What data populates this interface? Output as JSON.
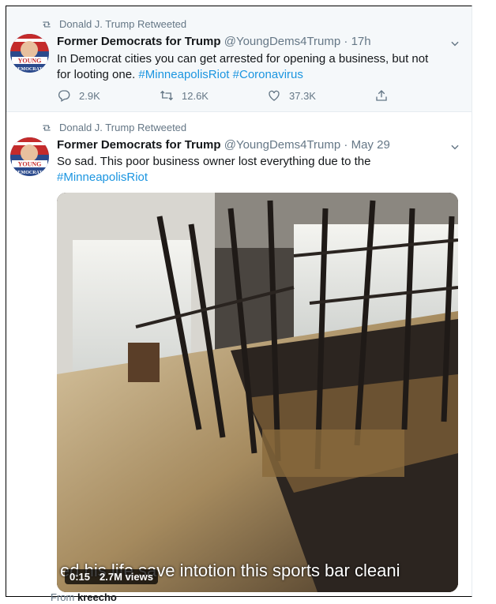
{
  "tweets": [
    {
      "retweeted_by": "Donald J. Trump Retweeted",
      "name": "Former Democrats for Trump",
      "handle": "@YoungDems4Trump",
      "sep": "·",
      "time": "17h",
      "text_plain": "In Democrat cities you can get arrested for opening a business, but not for looting one. ",
      "hashtags": [
        "#MinneapolisRiot",
        "#Coronavirus"
      ],
      "reply_count": "2.9K",
      "retweet_count": "12.6K",
      "like_count": "37.3K",
      "avatar_text": [
        "YOUNG",
        "DEMOCRATS"
      ]
    },
    {
      "retweeted_by": "Donald J. Trump Retweeted",
      "name": "Former Democrats for Trump",
      "handle": "@YoungDems4Trump",
      "sep": "·",
      "time": "May 29",
      "text_plain": "So sad. This poor business owner lost everything due to the",
      "hashtags": [
        "#MinneapolisRiot"
      ],
      "avatar_text": [
        "YOUNG",
        "DEMOCRATS"
      ],
      "video": {
        "caption": "ed his life save intotion this sports bar cleani",
        "duration": "0:15",
        "views": "2.7M views"
      },
      "from_label": "From",
      "from_user": "kreecho"
    }
  ],
  "colors": {
    "link": "#1b95e0",
    "muted": "#657786",
    "highlight_bg": "#f5f8fa"
  }
}
